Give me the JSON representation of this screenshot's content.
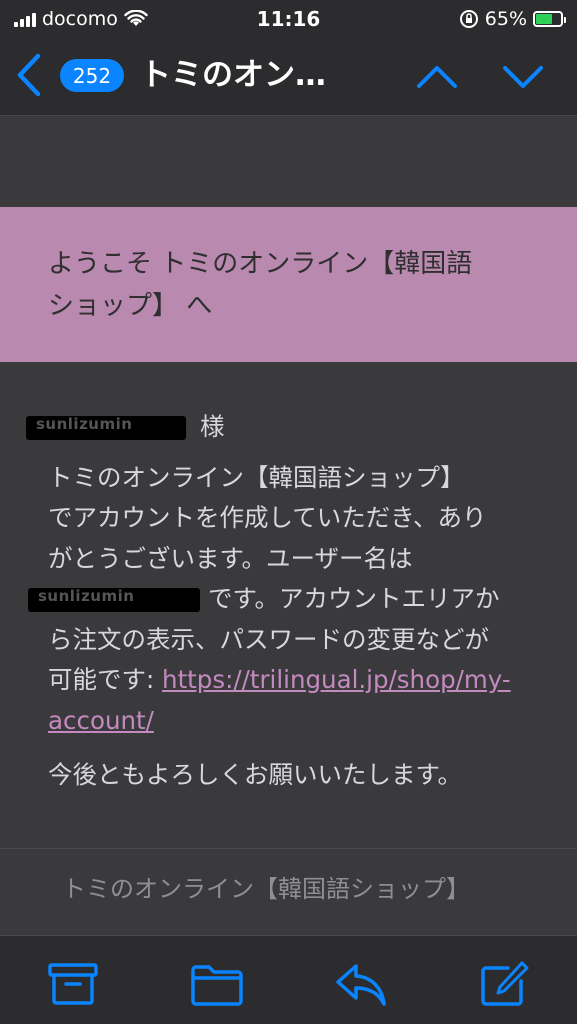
{
  "status": {
    "carrier": "docomo",
    "time": "11:16",
    "battery": "65%",
    "battery_level": 0.65
  },
  "nav": {
    "unread_count": "252",
    "title": "トミのオン…"
  },
  "email": {
    "banner_line1": "ようこそ トミのオンライン【韓国語",
    "banner_line2": "ショップ】 へ",
    "redacted1": "sunlizumin",
    "salutation_suffix": "様",
    "line1": "トミのオンライン【韓国語ショップ】",
    "line2": "でアカウントを作成していただき、あり",
    "line3": "がとうございます。ユーザー名は",
    "redacted2": "sunlizumin",
    "line4_after": "です。アカウントエリアか",
    "line5": "ら注文の表示、パスワードの変更などが",
    "line6_prefix": "可能です: ",
    "link_line1": "https://trilingual.jp/shop/my-",
    "link_line2": "account/",
    "closing": "今後ともよろしくお願いいたします。",
    "footer": "トミのオンライン【韓国語ショップ】"
  },
  "colors": {
    "accent": "#0a84ff",
    "banner": "#b989b0",
    "link": "#c48ac0",
    "battery": "#30d158"
  },
  "icons": {
    "archive": "archive-icon",
    "folder": "folder-icon",
    "reply": "reply-icon",
    "compose": "compose-icon"
  }
}
